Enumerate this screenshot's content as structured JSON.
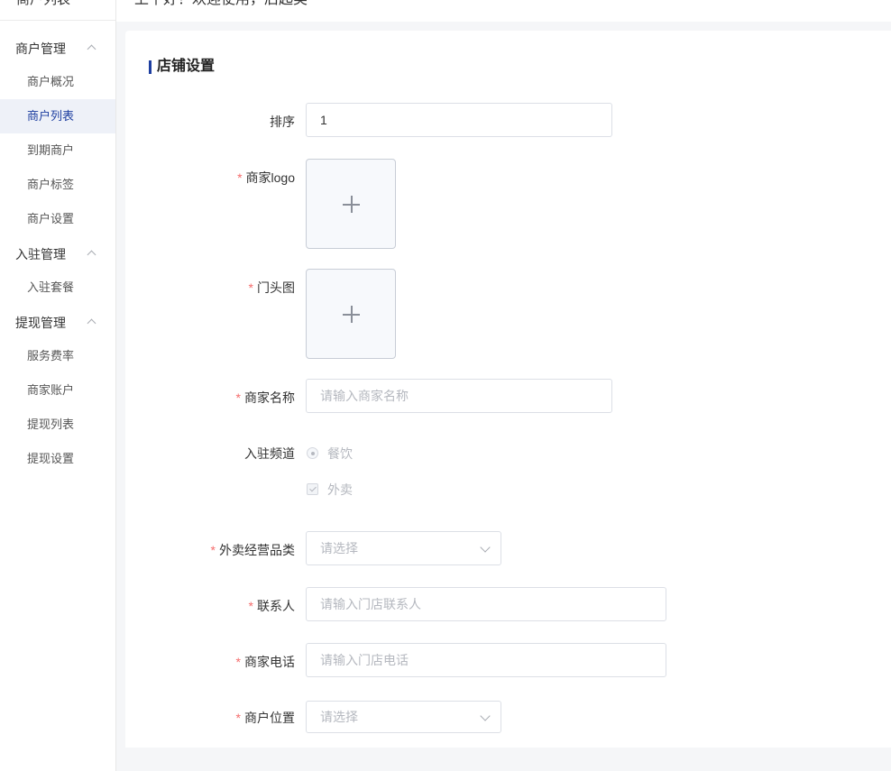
{
  "sidebar": {
    "title": "商户列表",
    "groups": [
      {
        "label": "商户管理",
        "items": [
          "商户概况",
          "商户列表",
          "到期商户",
          "商户标签",
          "商户设置"
        ]
      },
      {
        "label": "入驻管理",
        "items": [
          "入驻套餐"
        ]
      },
      {
        "label": "提现管理",
        "items": [
          "服务费率",
          "商家账户",
          "提现列表",
          "提现设置"
        ]
      }
    ],
    "active_item": "商户列表"
  },
  "header": {
    "text": "上午好！欢迎使用，后起美"
  },
  "section": {
    "title": "店铺设置"
  },
  "form": {
    "sort": {
      "label": "排序",
      "value": "1"
    },
    "logo": {
      "label": "商家logo",
      "required": "*"
    },
    "door_image": {
      "label": "门头图",
      "required": "*"
    },
    "merchant_name": {
      "label": "商家名称",
      "required": "*",
      "placeholder": "请输入商家名称"
    },
    "channel": {
      "label": "入驻频道",
      "options": [
        "餐饮",
        "外卖"
      ]
    },
    "category": {
      "label": "外卖经营品类",
      "required": "*",
      "placeholder": "请选择"
    },
    "contact": {
      "label": "联系人",
      "required": "*",
      "placeholder": "请输入门店联系人"
    },
    "phone": {
      "label": "商家电话",
      "required": "*",
      "placeholder": "请输入门店电话"
    },
    "location": {
      "label": "商户位置",
      "required": "*",
      "placeholder": "请选择"
    }
  },
  "icons": {
    "upload": "plus-icon",
    "select": "chevron-down-icon",
    "group": "chevron-up-icon"
  },
  "colors": {
    "accent": "#1d3ea0",
    "required": "#f56c6c",
    "active_bg": "#eef1f8"
  }
}
